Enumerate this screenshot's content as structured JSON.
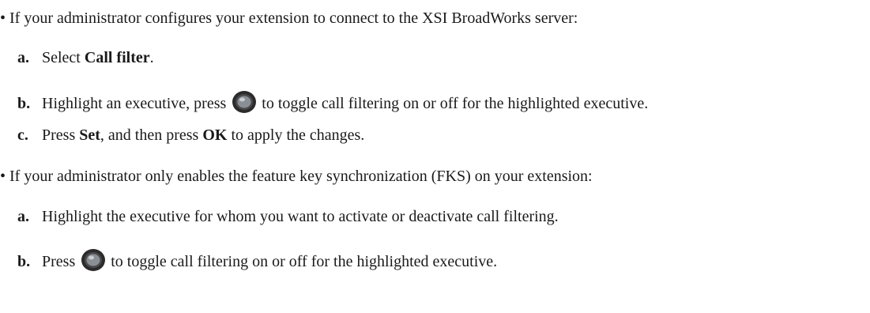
{
  "sections": [
    {
      "bullet": "•",
      "intro": "If your administrator configures your extension to connect to the XSI BroadWorks server:",
      "steps": [
        {
          "letter": "a.",
          "pre": "Select ",
          "bold1": "Call filter",
          "post": "."
        },
        {
          "letter": "b.",
          "pre": "Highlight an executive, press ",
          "icon": "navigation-select-button-icon",
          "post": " to toggle call filtering on or off for the highlighted executive."
        },
        {
          "letter": "c.",
          "pre": "Press ",
          "bold1": "Set",
          "mid": ", and then press ",
          "bold2": "OK",
          "post": " to apply the changes."
        }
      ]
    },
    {
      "bullet": "•",
      "intro": "If your administrator only enables the feature key synchronization (FKS) on your extension:",
      "steps": [
        {
          "letter": "a.",
          "text": "Highlight the executive for whom you want to activate or deactivate call filtering."
        },
        {
          "letter": "b.",
          "pre": "Press ",
          "icon": "navigation-select-button-icon",
          "post": " to toggle call filtering on or off for the highlighted executive."
        }
      ]
    }
  ]
}
